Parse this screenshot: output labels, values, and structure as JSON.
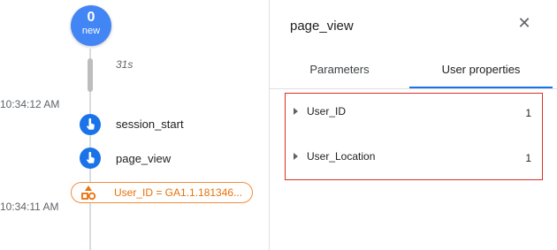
{
  "timeline": {
    "new_count": "0",
    "new_label": "new",
    "gap_label": "31s",
    "times": [
      "10:34:12 AM",
      "10:34:11 AM"
    ],
    "events": [
      {
        "name": "session_start",
        "icon": "touch-icon",
        "color": "#1a73e8"
      },
      {
        "name": "page_view",
        "icon": "touch-icon",
        "color": "#1a73e8"
      }
    ],
    "user_property_chip": {
      "text": "User_ID = GA1.1.181346...",
      "icon": "shapes-icon",
      "color": "#e8710a"
    }
  },
  "panel": {
    "title": "page_view",
    "close_icon": "close-icon",
    "tabs": [
      {
        "label": "Parameters",
        "active": false
      },
      {
        "label": "User properties",
        "active": true
      }
    ],
    "accent_color": "#1a73e8",
    "highlight_color": "#d93025",
    "rows": [
      {
        "label": "User_ID",
        "value": "1"
      },
      {
        "label": "User_Location",
        "value": "1"
      }
    ]
  }
}
